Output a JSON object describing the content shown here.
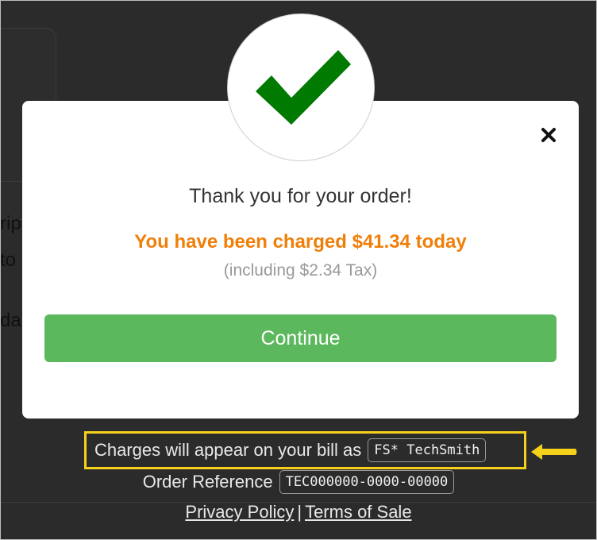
{
  "background": {
    "partial_text_1": "rip",
    "partial_text_2": "to",
    "partial_text_3": "da"
  },
  "modal": {
    "check_icon": "checkmark-icon",
    "close_icon": "close-icon",
    "thanks": "Thank you for your order!",
    "charged": "You have been charged $41.34 today",
    "tax_note": "(including $2.34 Tax)",
    "continue_label": "Continue"
  },
  "footer": {
    "bill_label": "Charges will appear on your bill as",
    "bill_descriptor": "FS* TechSmith",
    "order_label": "Order Reference",
    "order_reference": "TEC000000-0000-00000",
    "privacy_link": "Privacy Policy",
    "separator": "|",
    "terms_link": "Terms of Sale"
  },
  "colors": {
    "accent_orange": "#f07f09",
    "continue_green": "#5cb85c",
    "check_green": "#007a00",
    "highlight_yellow": "#f5d11c"
  }
}
